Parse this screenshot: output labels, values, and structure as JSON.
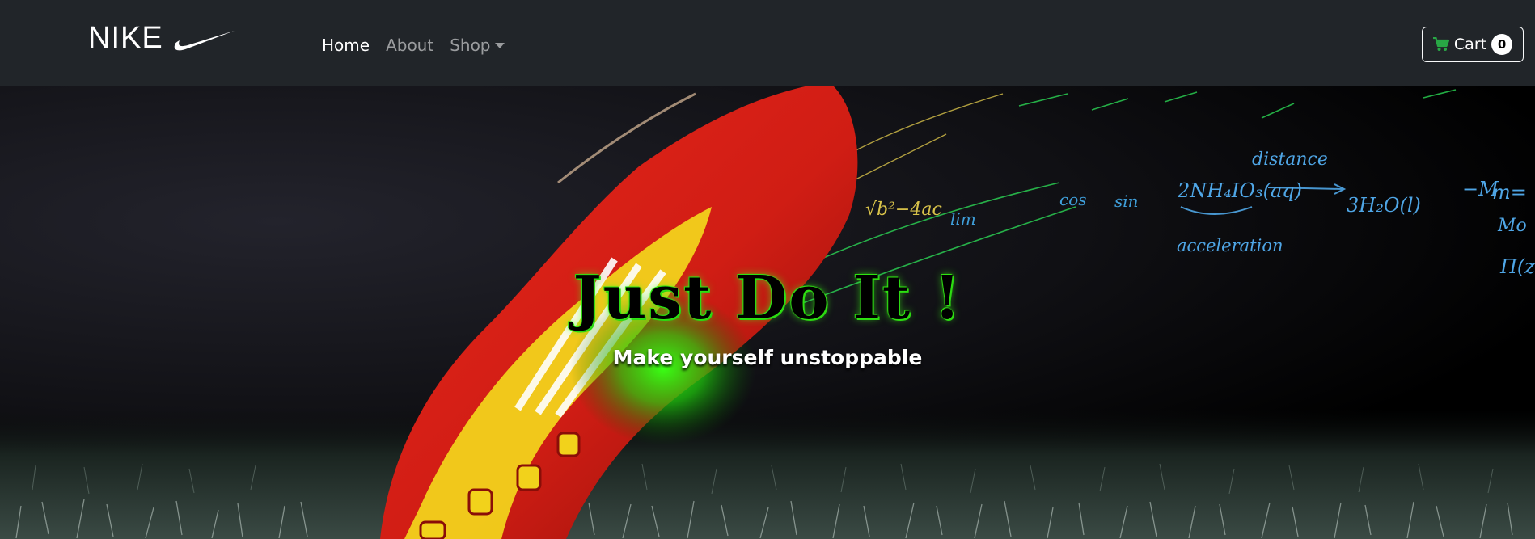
{
  "navbar": {
    "brand": "NIKE",
    "brand_logo": "swoosh-icon",
    "links": [
      {
        "label": "Home",
        "active": true
      },
      {
        "label": "About",
        "active": false
      },
      {
        "label": "Shop",
        "active": false,
        "dropdown": true
      }
    ],
    "cart": {
      "label": "Cart",
      "count": "0",
      "icon": "shopping-cart-icon"
    }
  },
  "hero": {
    "title": "Just Do It !",
    "subtitle": "Make yourself unstoppable",
    "background": "football boot on grass with chalk equations",
    "formula_texts": [
      "distance",
      "acceleration",
      "2NH₄IO₃(aq)",
      "3H₂O(l)",
      "lim",
      "cos",
      "sin",
      "√b²−4ac",
      "Π(z",
      "Mo",
      "−M",
      "m="
    ]
  },
  "colors": {
    "navbar_bg": "#212529",
    "accent_green": "#39ff14",
    "cart_icon": "#28a745",
    "boot_red": "#d4201a",
    "boot_yellow": "#f2d21b",
    "formula_blue": "#4fa6e6"
  }
}
